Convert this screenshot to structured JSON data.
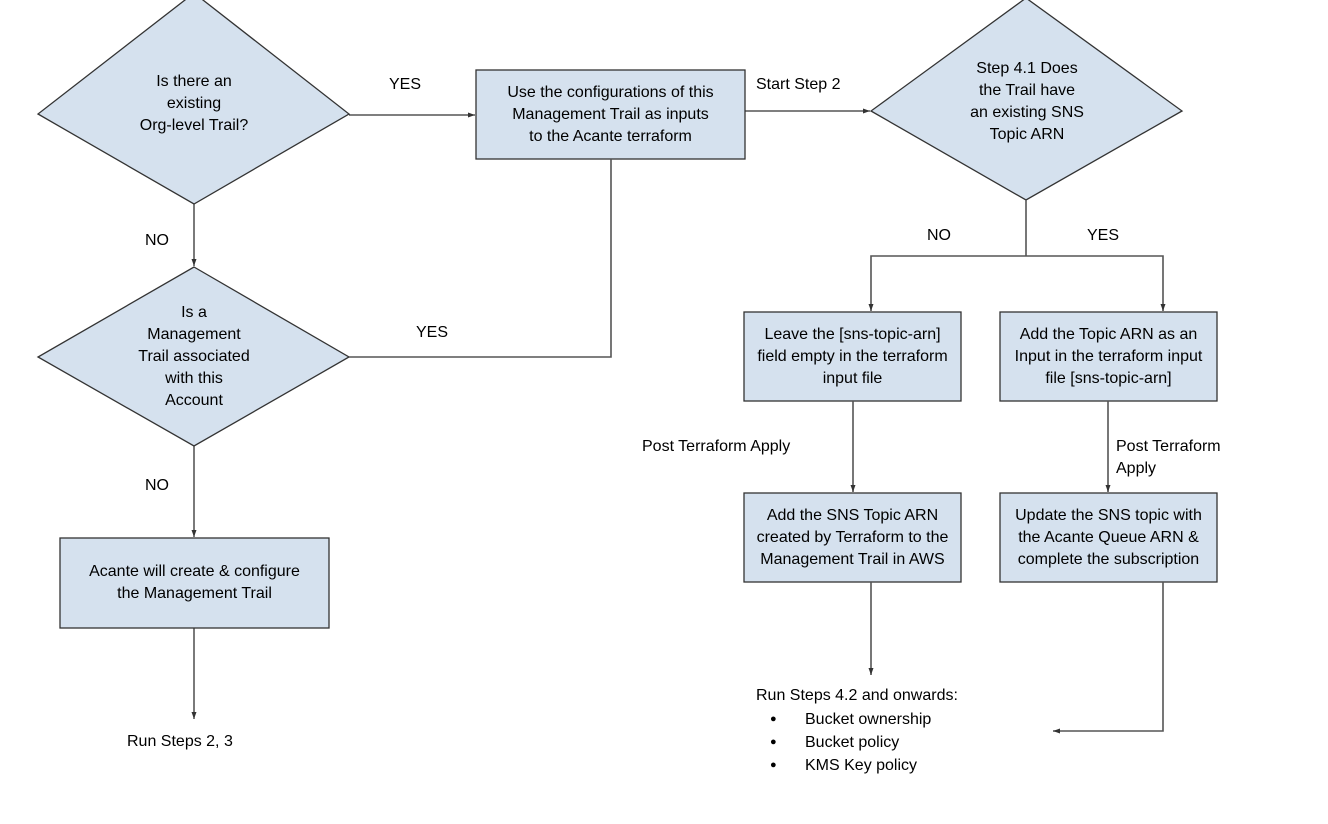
{
  "diagram": {
    "type": "flowchart",
    "colors": {
      "node_fill": "#d5e1ee",
      "stroke": "#333333",
      "background": "#ffffff"
    },
    "nodes": {
      "q_org_trail": {
        "shape": "diamond",
        "text": "Is there an\nexisting\nOrg-level Trail?"
      },
      "use_config": {
        "shape": "rectangle",
        "text": "Use the configurations of this\nManagement Trail as inputs\nto the Acante terraform"
      },
      "q_mgmt_trail": {
        "shape": "diamond",
        "text": "Is a\nManagement\nTrail associated\nwith this\nAccount"
      },
      "acante_create": {
        "shape": "rectangle",
        "text": "Acante will create & configure\nthe Management Trail"
      },
      "q_sns_topic": {
        "shape": "diamond",
        "text": "Step 4.1 Does\nthe Trail have\nan existing SNS\nTopic ARN"
      },
      "leave_empty": {
        "shape": "rectangle",
        "text": "Leave the [sns-topic-arn]\nfield empty in the terraform\ninput file"
      },
      "add_topic_input": {
        "shape": "rectangle",
        "text": "Add the Topic ARN as an\nInput in the terraform input\nfile [sns-topic-arn]"
      },
      "add_sns_to_trail": {
        "shape": "rectangle",
        "text": "Add the SNS Topic ARN\ncreated by Terraform to the\nManagement Trail in AWS"
      },
      "update_sns": {
        "shape": "rectangle",
        "text": "Update the SNS topic with\nthe Acante Queue ARN &\ncomplete the subscription"
      }
    },
    "edge_labels": {
      "org_yes": "YES",
      "org_no": "NO",
      "mgmt_yes": "YES",
      "mgmt_no": "NO",
      "start_step2": "Start Step 2",
      "sns_no": "NO",
      "sns_yes": "YES",
      "post_apply_left": "Post Terraform Apply",
      "post_apply_right": "Post Terraform\nApply"
    },
    "terminals": {
      "run_steps_left": "Run Steps  2, 3",
      "run_steps_right": {
        "heading": "Run Steps  4.2 and onwards:",
        "items": [
          "Bucket ownership",
          "Bucket policy",
          "KMS Key policy"
        ]
      }
    }
  }
}
